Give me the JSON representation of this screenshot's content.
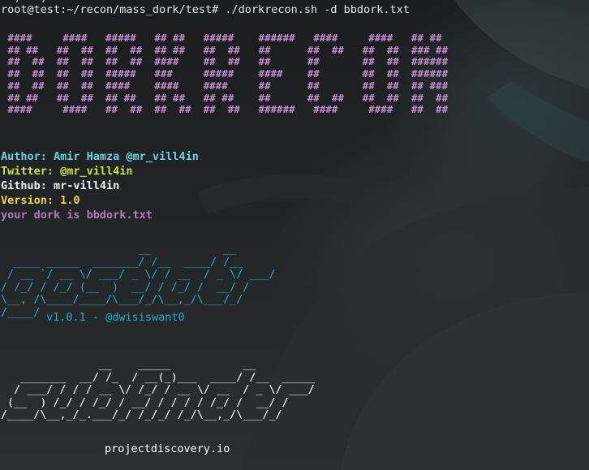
{
  "terminal": {
    "top_partial": "  ,   ,",
    "prompt": "root@test:~/recon/mass_dork/test# ./dorkrecon.sh -d bbdork.txt",
    "banner_lines": [
      " ####     ####   #####   ## ##   #####    ######   ####     ####   ## ##",
      " ## ##   ##  ##  ##  ##  ## ##   ##  ##   ##      ##  ##   ##  ##  ### ##",
      " ##  ##  ##  ##  ##  ##  ####    ##  ##   ##      ##       ##  ##  ######",
      " ##  ##  ##  ##  #####   ###     #####    ####    ##       ##  ##  ######",
      " ##  ##  ##  ##  ####    ####    ####     ##      ##       ##  ##  ## ###",
      " ## ##   ##  ##  ## ##   ## ##   ## ##    ##      ##  ##   ##  ##  ##  ##",
      " ####     ####   ##  ##  ##  ##  ##  ##   ######   ####     ####   ##  ##"
    ],
    "author": "Author: Amir Hamza @mr_vill4in",
    "twitter": "Twitter: @mr_vill4in",
    "github": "Github: mr-vill4in",
    "version": "Version: 1.0",
    "dork": "your dork is bbdork.txt",
    "gospider_art": "                     __           __\n  ____ _____  _______/ /__  ____/ /__\n / __ `/ __ \\/ ___/ _ \\/ / __  / _ \\/ ___/\n/ /_/ / /_/ (__  )  __/ / /_/ /  __/ /\n\\__, /\\____/____/\\___/_/\\__,_/\\___/_/\n/____/",
    "gospider_version": "v1.0.1 - @dwisiswant0",
    "subfinder_art": "               __    _____           __\n   _______  __/ /_  / __(_)___  ____/ /__  _____\n  / ___/ / / / __ \\/ /_/ / __ \\/ __  / _ \\/ ___/\n (__  ) /_/ / /_/ / __/ / / / / /_/ /  __/ /\n/____/\\__,_/_.___/_/ /_/_/ /_/\\__,_/\\___/_/",
    "subfinder_site": "projectdiscovery.io"
  },
  "colors": {
    "background": "#202224",
    "banner": "#c48ccf",
    "author": "#6fd3e0",
    "twitter": "#c6e44a",
    "github": "#f2f2f2",
    "version": "#f0d34b",
    "dork": "#b07ab8",
    "gospider": "#1fb0c6",
    "subfinder": "#ffffff"
  }
}
